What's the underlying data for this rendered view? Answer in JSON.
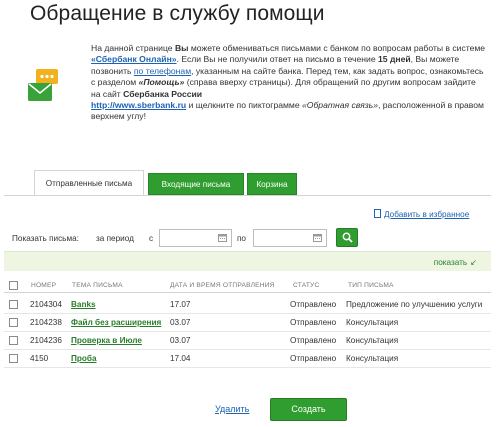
{
  "page": {
    "title": "Обращение в службу помощи"
  },
  "info": {
    "p1": "На данной странице ",
    "p1_you": "Вы",
    "p2": " можете обмениваться письмами с банком по вопросам работы в системе ",
    "system": "«Сбербанк Онлайн»",
    "p3": ". Если Вы не получили ответ на письмо в течение ",
    "days": "15 дней",
    "p4": ", Вы можете позвонить ",
    "phones_link": "по телефонам",
    "p5": ", указанным на сайте банка. Перед тем, как задать вопрос, ознакомьтесь с разделом ",
    "help": "«Помощь»",
    "p6": " (справа вверху страницы). Для обращений по другим вопросам зайдите на сайт ",
    "sber": "Сбербанка России",
    "url": "http://www.sberbank.ru",
    "p7": " и щелкните по пиктограмме ",
    "feedback": "«Обратная связь»",
    "p8": ", расположенной в правом верхнем углу!"
  },
  "tabs": [
    {
      "label": "Отправленные письма",
      "active": true
    },
    {
      "label": "Входящие письма",
      "active": false
    },
    {
      "label": "Корзина",
      "active": false
    }
  ],
  "favorites": {
    "label": "Добавить в избранное"
  },
  "filter": {
    "label": "Показать письма:",
    "period_label": "за период",
    "from_label": "с",
    "to_label": "по",
    "from_value": "",
    "to_value": ""
  },
  "show": {
    "label": "показать"
  },
  "table": {
    "headers": [
      "НОМЕР",
      "ТЕМА ПИСЬМА",
      "ДАТА И ВРЕМЯ ОТПРАВЛЕНИЯ",
      "СТАТУС",
      "ТИП ПИСЬМА"
    ],
    "rows": [
      {
        "number": "2104304",
        "subject": "Banks",
        "date": "17.07",
        "status": "Отправлено",
        "type": "Предложение по улучшению услуги"
      },
      {
        "number": "2104238",
        "subject": "Файл без расширения",
        "date": "03.07",
        "status": "Отправлено",
        "type": "Консультация"
      },
      {
        "number": "2104236",
        "subject": "Проверка в Июле",
        "date": "03.07",
        "status": "Отправлено",
        "type": "Консультация"
      },
      {
        "number": "4150",
        "subject": "Проба",
        "date": "17.04",
        "status": "Отправлено",
        "type": "Консультация"
      }
    ]
  },
  "actions": {
    "delete": "Удалить",
    "create": "Создать"
  },
  "colors": {
    "green": "#2f9d2f",
    "link_blue": "#1e62b3",
    "subject_green": "#2a7d2a",
    "bar_bg": "#eef6e2"
  }
}
